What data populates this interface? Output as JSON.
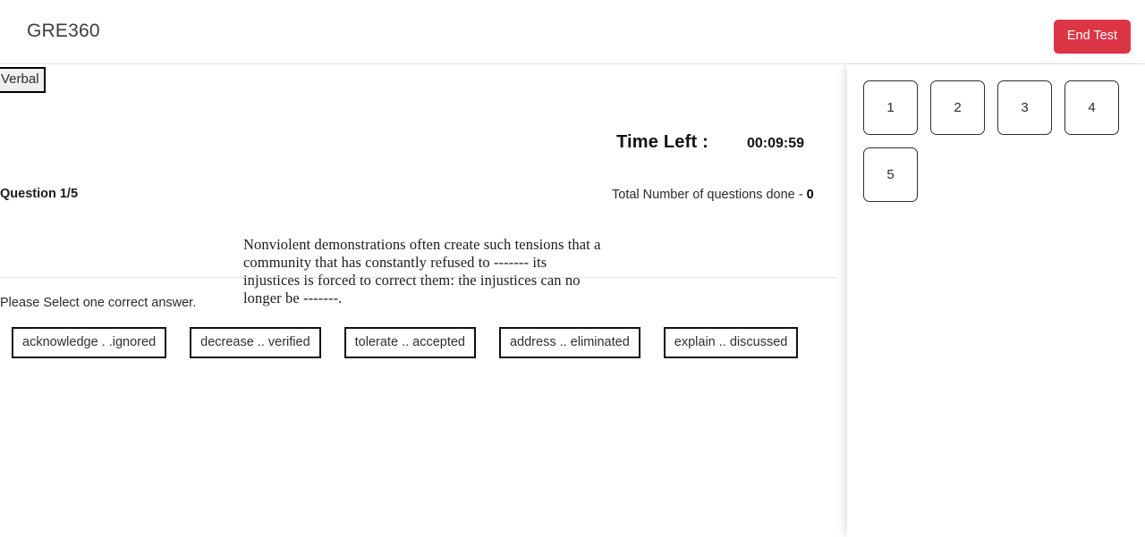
{
  "header": {
    "brand": "GRE360",
    "end_test_label": "End Test",
    "accent_color": "#dc3545"
  },
  "exam": {
    "subject_tab": "Verbal",
    "time_left_label": "Time Left :",
    "time_left_value": "00:09:59",
    "question_counter": "Question 1/5",
    "questions_done_text": "Total Number of questions done - ",
    "questions_done_count": "0",
    "instruction": "Please Select one correct answer.",
    "question_passage": "Nonviolent demonstrations often create such tensions that a community that has constantly refused to ------- its injustices is forced to correct them:   the injustices can no longer be -------.",
    "options": [
      {
        "label": "acknowledge . .ignored"
      },
      {
        "label": "decrease .. verified"
      },
      {
        "label": "tolerate .. accepted"
      },
      {
        "label": "address .. eliminated"
      },
      {
        "label": "explain .. discussed"
      }
    ]
  },
  "navigator": {
    "items": [
      {
        "number": "1"
      },
      {
        "number": "2"
      },
      {
        "number": "3"
      },
      {
        "number": "4"
      },
      {
        "number": "5"
      }
    ]
  }
}
